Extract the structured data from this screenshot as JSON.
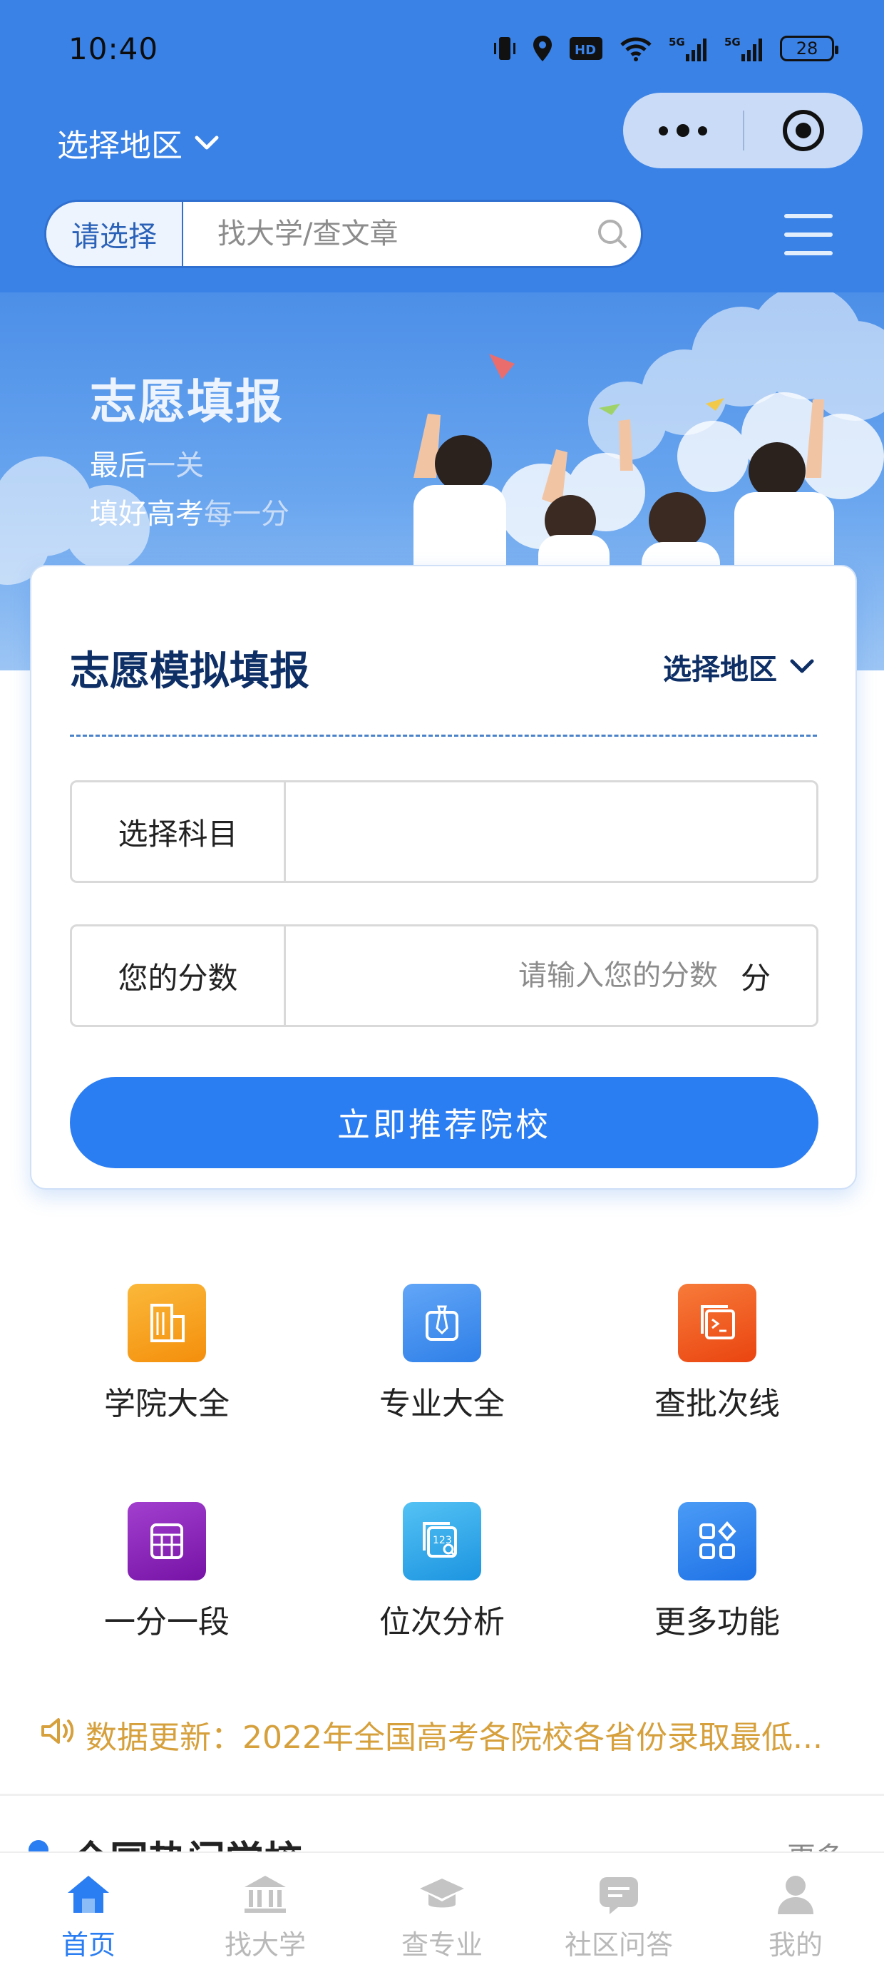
{
  "status_bar": {
    "time": "10:40",
    "battery": "28",
    "network": "5G"
  },
  "header": {
    "region_label": "选择地区",
    "search_select": "请选择",
    "search_placeholder": "找大学/查文章"
  },
  "banner": {
    "title": "志愿填报",
    "line1_a": "最后",
    "line1_b": "一关",
    "line2_a": "填好高考",
    "line2_b": "每一分"
  },
  "form": {
    "title": "志愿模拟填报",
    "region_label": "选择地区",
    "subject_label": "选择科目",
    "subject_value": "",
    "score_label": "您的分数",
    "score_placeholder": "请输入您的分数",
    "score_unit": "分",
    "submit_label": "立即推荐院校"
  },
  "features": [
    {
      "label": "学院大全",
      "icon": "building-icon",
      "color": "#f7a21b"
    },
    {
      "label": "专业大全",
      "icon": "tie-icon",
      "color": "#3e8ef0"
    },
    {
      "label": "查批次线",
      "icon": "terminal-icon",
      "color": "#f05a22"
    },
    {
      "label": "一分一段",
      "icon": "calculator-icon",
      "color": "#8a1fb3"
    },
    {
      "label": "位次分析",
      "icon": "rank-search-icon",
      "color": "#2aa7ea"
    },
    {
      "label": "更多功能",
      "icon": "grid-apps-icon",
      "color": "#2f86f0"
    }
  ],
  "notice": {
    "text": "数据更新：2022年全国高考各院校各省份录取最低..."
  },
  "section": {
    "title": "全国热门学校",
    "more": "更多"
  },
  "tabs": [
    {
      "label": "首页",
      "icon": "home-icon",
      "active": true
    },
    {
      "label": "找大学",
      "icon": "university-icon",
      "active": false
    },
    {
      "label": "查专业",
      "icon": "graduation-cap-icon",
      "active": false
    },
    {
      "label": "社区问答",
      "icon": "chat-icon",
      "active": false
    },
    {
      "label": "我的",
      "icon": "user-icon",
      "active": false
    }
  ],
  "colors": {
    "primary": "#2b7df2",
    "header_bg": "#3a82e6",
    "notice": "#d6a03c",
    "title_navy": "#0e2f66"
  }
}
